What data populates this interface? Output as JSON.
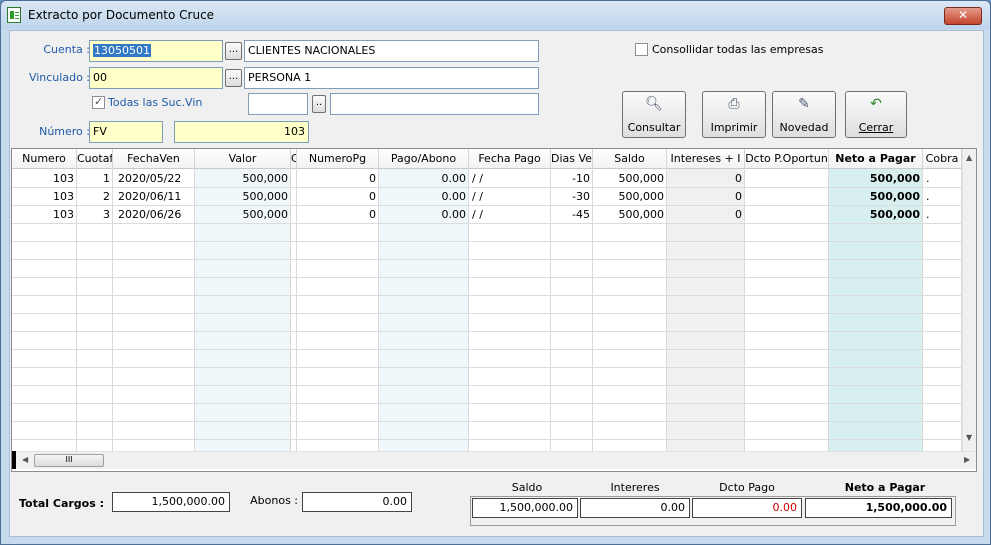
{
  "window": {
    "title": "Extracto por Documento Cruce",
    "close_symbol": "✕"
  },
  "form": {
    "cuenta_label": "Cuenta :",
    "cuenta_value": "13050501",
    "cuenta_desc": "CLIENTES NACIONALES",
    "vinculado_label": "Vinculado :",
    "vinculado_value": "00",
    "vinculado_desc": "PERSONA 1",
    "todas_label": "Todas las Suc.Vin",
    "numero_label": "Número :",
    "numero_prefix": "FV",
    "numero_value": "103",
    "consolidar_label": "Consollidar todas las empresas",
    "dots": "...",
    "small_dots": ".."
  },
  "toolbar": {
    "consultar": "Consultar",
    "imprimir": "Imprimir",
    "novedad": "Novedad",
    "cerrar": "Cerrar"
  },
  "grid": {
    "headers": {
      "numero": "Numero",
      "cuota": "Cuotaf",
      "fechaven": "FechaVen",
      "valor": "Valor",
      "c": "C",
      "numeropg": "NumeroPg",
      "pago": "Pago/Abono",
      "fechapago": "Fecha Pago",
      "diasven": "Dias Ven",
      "saldo": "Saldo",
      "intereses": "Intereses + I",
      "dcto": "Dcto P.Oportun",
      "neto": "Neto a Pagar",
      "cobra": "Cobra"
    },
    "rows": [
      {
        "numero": "103",
        "cuota": "1",
        "fechaven": "2020/05/22",
        "valor": "500,000",
        "numeropg": "0",
        "pago": "0.00",
        "fechapago": "/ /",
        "dias": "-10",
        "saldo": "500,000",
        "intereses": "0",
        "neto": "500,000",
        "cobra": "."
      },
      {
        "numero": "103",
        "cuota": "2",
        "fechaven": "2020/06/11",
        "valor": "500,000",
        "numeropg": "0",
        "pago": "0.00",
        "fechapago": "/ /",
        "dias": "-30",
        "saldo": "500,000",
        "intereses": "0",
        "neto": "500,000",
        "cobra": "."
      },
      {
        "numero": "103",
        "cuota": "3",
        "fechaven": "2020/06/26",
        "valor": "500,000",
        "numeropg": "0",
        "pago": "0.00",
        "fechapago": "/ /",
        "dias": "-45",
        "saldo": "500,000",
        "intereses": "0",
        "neto": "500,000",
        "cobra": "."
      }
    ],
    "scroll_thumb": "III"
  },
  "footer": {
    "total_cargos_label": "Total Cargos :",
    "total_cargos_value": "1,500,000.00",
    "abonos_label": "Abonos :",
    "abonos_value": "0.00",
    "saldo_label": "Saldo",
    "saldo_value": "1,500,000.00",
    "intereses_label": "Intereres",
    "intereses_value": "0.00",
    "dcto_label": "Dcto Pago",
    "dcto_value": "0.00",
    "neto_label": "Neto a Pagar",
    "neto_value": "1,500,000.00"
  },
  "colors": {
    "label_blue": "#1f5aa8",
    "yellow_field": "#ffffc8",
    "dcto_red": "#d00000",
    "teal_col": "#d8efef"
  }
}
